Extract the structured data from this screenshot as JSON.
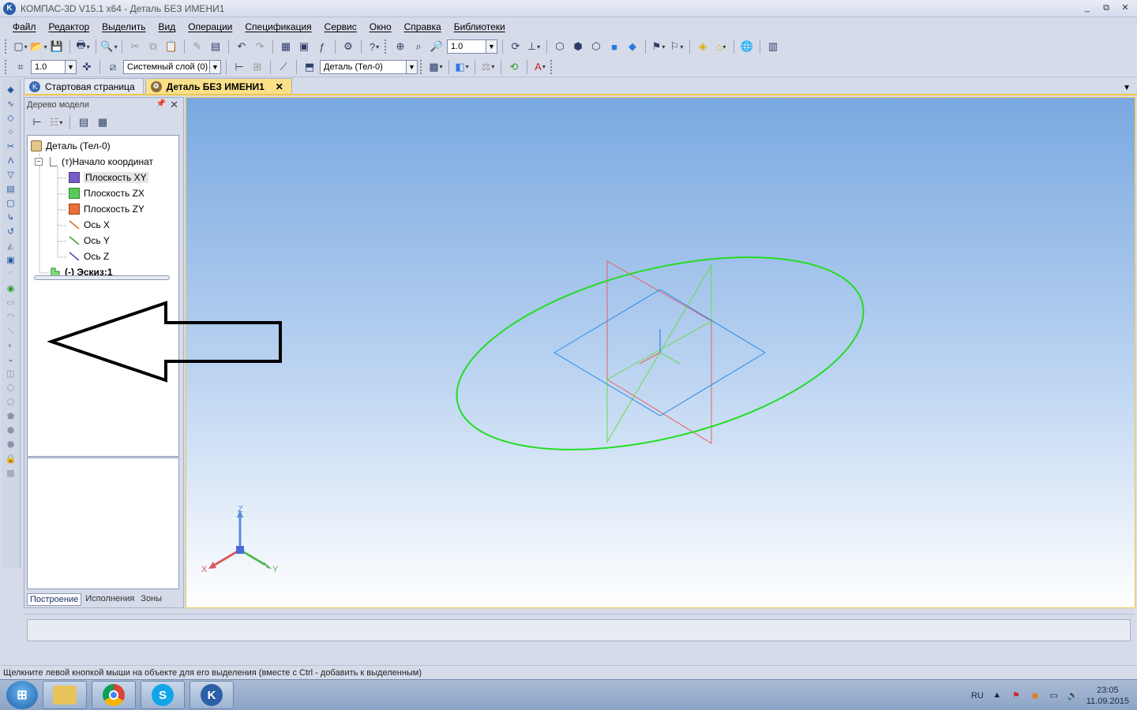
{
  "window": {
    "title": "КОМПАС-3D V15.1 x64 - Деталь БЕЗ ИМЕНИ1",
    "controls": [
      "_",
      "⧉",
      "✕"
    ]
  },
  "menu": [
    "Файл",
    "Редактор",
    "Выделить",
    "Вид",
    "Операции",
    "Спецификация",
    "Сервис",
    "Окно",
    "Справка",
    "Библиотеки"
  ],
  "toolbar1": {
    "zoom_value": "1.0"
  },
  "toolbar2": {
    "step_value": "1.0",
    "layer_value": "Системный слой (0)",
    "body_value": "Деталь (Тел-0)"
  },
  "tabs": [
    {
      "label": "Стартовая страница"
    },
    {
      "label": "Деталь БЕЗ ИМЕНИ1",
      "close": "✕"
    }
  ],
  "tree_panel": {
    "title": "Дерево модели",
    "items": [
      {
        "label": "Деталь (Тел-0)"
      },
      {
        "label": "(т)Начало координат"
      },
      {
        "label": "Плоскость XY"
      },
      {
        "label": "Плоскость ZX"
      },
      {
        "label": "Плоскость ZY"
      },
      {
        "label": "Ось X"
      },
      {
        "label": "Ось Y"
      },
      {
        "label": "Ось Z"
      },
      {
        "label": "(-) Эскиз:1"
      }
    ],
    "bottom_tabs": [
      "Построение",
      "Исполнения",
      "Зоны"
    ]
  },
  "triad": {
    "z": "Z",
    "x": "X",
    "y": "Y"
  },
  "status_text": "Щелкните левой кнопкой мыши на объекте для его выделения (вместе с Ctrl - добавить к выделенным)",
  "tray": {
    "lang": "RU",
    "time": "23:05",
    "date": "11.09.2015"
  },
  "colors": {
    "sketch_circle": "#22dd22",
    "plane_xy": "#2a8ae8",
    "plane_zx": "#66dd44",
    "plane_zy": "#e86060",
    "tab_active": "#fbe08a"
  }
}
